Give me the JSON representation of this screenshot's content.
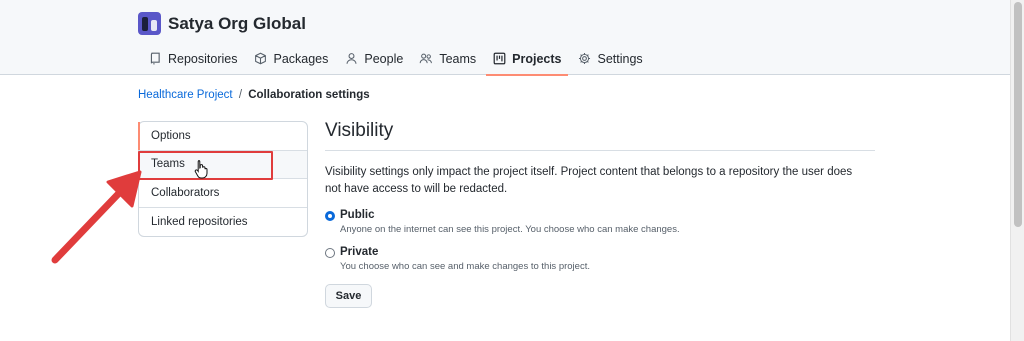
{
  "org": {
    "name": "Satya Org Global",
    "avatar_icon": "org-avatar"
  },
  "tabs": [
    {
      "label": "Repositories",
      "icon": "repo-icon"
    },
    {
      "label": "Packages",
      "icon": "package-icon"
    },
    {
      "label": "People",
      "icon": "person-icon"
    },
    {
      "label": "Teams",
      "icon": "people-icon"
    },
    {
      "label": "Projects",
      "icon": "project-icon",
      "active": true
    },
    {
      "label": "Settings",
      "icon": "gear-icon"
    }
  ],
  "breadcrumb": {
    "project": "Healthcare Project",
    "separator": "/",
    "current": "Collaboration settings"
  },
  "side_menu": [
    {
      "label": "Options",
      "selected": true
    },
    {
      "label": "Teams",
      "hovered": true
    },
    {
      "label": "Collaborators"
    },
    {
      "label": "Linked repositories"
    }
  ],
  "visibility": {
    "heading": "Visibility",
    "description": "Visibility settings only impact the project itself. Project content that belongs to a repository the user does not have access to will be redacted.",
    "options": [
      {
        "label": "Public",
        "note": "Anyone on the internet can see this project. You choose who can make changes.",
        "checked": true
      },
      {
        "label": "Private",
        "note": "You choose who can see and make changes to this project.",
        "checked": false
      }
    ],
    "save_label": "Save"
  },
  "colors": {
    "accent_tab": "#fd8c73",
    "link": "#0969da",
    "annotation": "#e03c3c"
  }
}
